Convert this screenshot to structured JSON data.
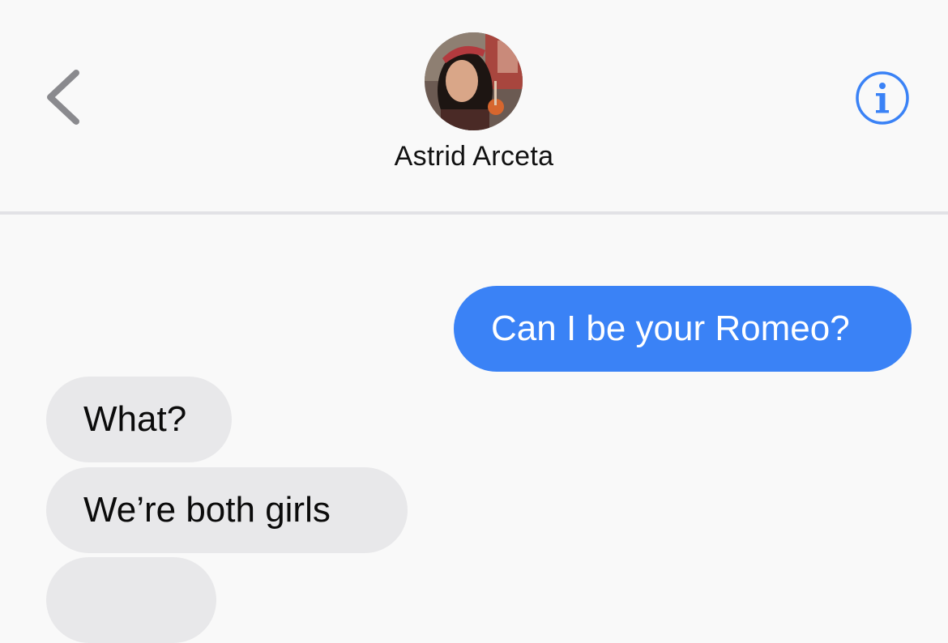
{
  "header": {
    "contact_name": "Astrid Arceta",
    "back_icon": "chevron-left-icon",
    "info_icon": "info-icon",
    "accent_color": "#3a82f6"
  },
  "messages": [
    {
      "direction": "sent",
      "text": "Can I be your Romeo?"
    },
    {
      "direction": "received",
      "text": "What?"
    },
    {
      "direction": "received",
      "text": "We’re both girls"
    },
    {
      "direction": "received",
      "text": ""
    }
  ],
  "colors": {
    "sent_bubble": "#3a82f6",
    "received_bubble": "#e8e8ea",
    "background": "#f9f9f9"
  }
}
